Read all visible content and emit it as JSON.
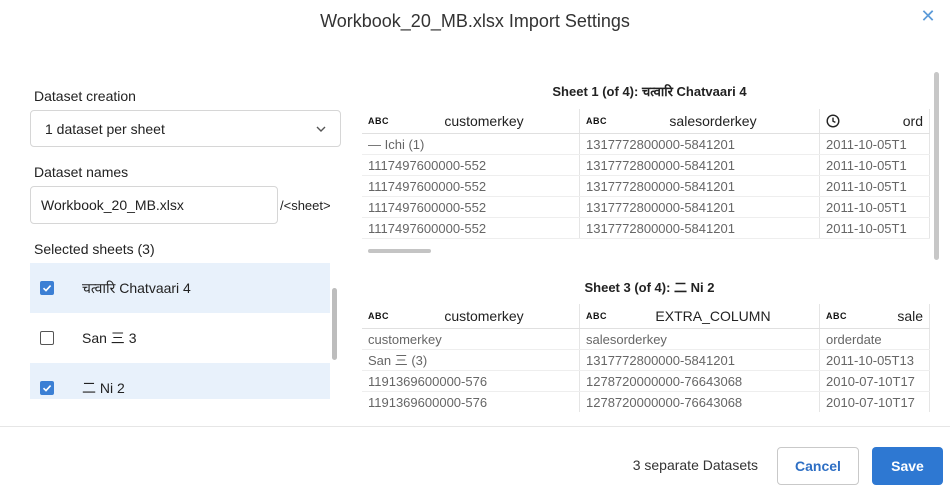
{
  "dialog": {
    "title": "Workbook_20_MB.xlsx Import Settings",
    "close_icon": "close-icon"
  },
  "left": {
    "dataset_creation_label": "Dataset creation",
    "dataset_creation_value": "1 dataset per sheet",
    "dataset_names_label": "Dataset names",
    "dataset_name_value": "Workbook_20_MB.xlsx",
    "dataset_name_suffix": "/<sheet>",
    "selected_sheets_label": "Selected sheets (3)",
    "sheets": [
      {
        "label": "चत्वारि Chatvaari 4",
        "checked": true
      },
      {
        "label": "San 三 3",
        "checked": false
      },
      {
        "label": "二 Ni 2",
        "checked": true
      }
    ]
  },
  "previews": [
    {
      "title": "Sheet 1 (of 4): चत्वारि Chatvaari 4",
      "columns": [
        {
          "type": "ABC",
          "name": "customerkey"
        },
        {
          "type": "ABC",
          "name": "salesorderkey"
        },
        {
          "type": "clock-icon",
          "name": "ord"
        }
      ],
      "rows": [
        [
          "— Ichi (1)",
          "1317772800000-5841201",
          "2011-10-05T1"
        ],
        [
          "1117497600000-552",
          "1317772800000-5841201",
          "2011-10-05T1"
        ],
        [
          "1117497600000-552",
          "1317772800000-5841201",
          "2011-10-05T1"
        ],
        [
          "1117497600000-552",
          "1317772800000-5841201",
          "2011-10-05T1"
        ],
        [
          "1117497600000-552",
          "1317772800000-5841201",
          "2011-10-05T1"
        ]
      ]
    },
    {
      "title": "Sheet 3 (of 4): 二 Ni 2",
      "columns": [
        {
          "type": "ABC",
          "name": "customerkey"
        },
        {
          "type": "ABC",
          "name": "EXTRA_COLUMN"
        },
        {
          "type": "ABC",
          "name": "sale"
        }
      ],
      "rows": [
        [
          "customerkey",
          "salesorderkey",
          "orderdate"
        ],
        [
          "San 三 (3)",
          "1317772800000-5841201",
          "2011-10-05T13"
        ],
        [
          "1191369600000-576",
          "1278720000000-76643068",
          "2010-07-10T17"
        ],
        [
          "1191369600000-576",
          "1278720000000-76643068",
          "2010-07-10T17"
        ]
      ]
    }
  ],
  "footer": {
    "summary": "3 separate Datasets",
    "cancel_label": "Cancel",
    "save_label": "Save"
  },
  "colors": {
    "accent": "#2e78d2",
    "selected_bg": "#e8f1fb"
  }
}
